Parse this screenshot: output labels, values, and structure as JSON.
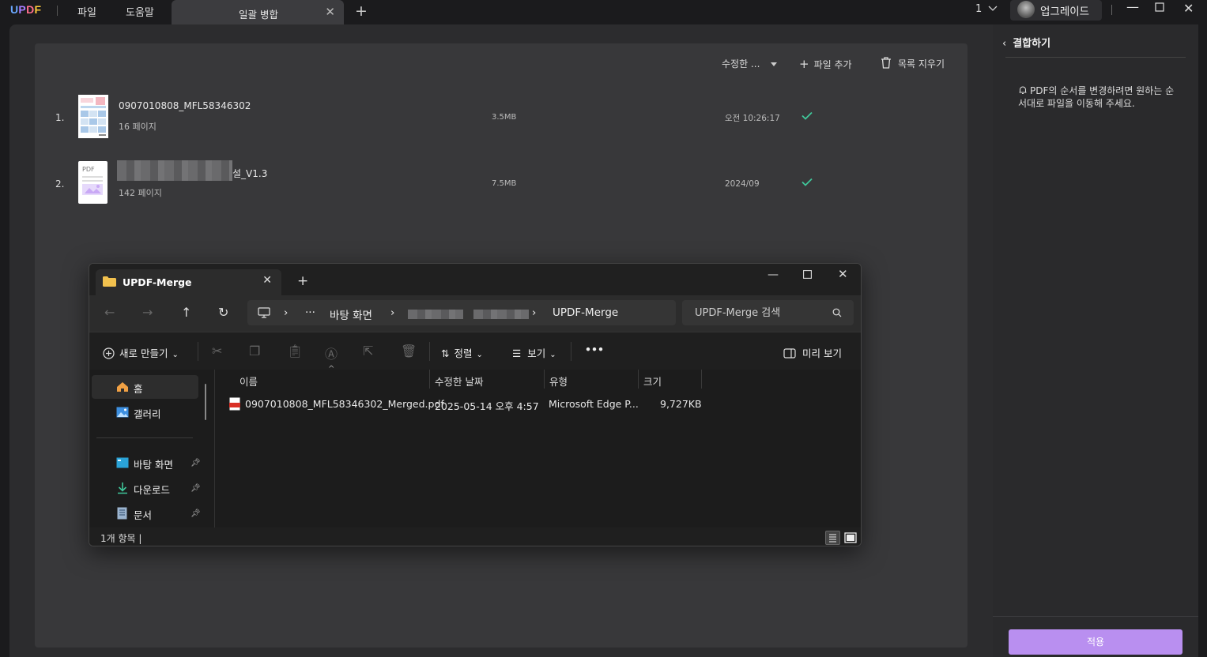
{
  "app": {
    "logo": {
      "u": "U",
      "p": "P",
      "d": "D",
      "f": "F"
    },
    "menu": [
      "파일",
      "도움말"
    ],
    "active_tab": "일괄 병합",
    "page_select": "1",
    "upgrade_label": "업그레이드"
  },
  "toolbar": {
    "sort_label": "수정한 ...",
    "add_file": "파일 추가",
    "clear_list": "목록 지우기"
  },
  "files": [
    {
      "index": "1.",
      "name": "0907010808_MFL58346302",
      "pages": "16 페이지",
      "size": "3.5MB",
      "date": "오전 10:26:17"
    },
    {
      "index": "2.",
      "name": "설_V1.3",
      "pages": "142 페이지",
      "size": "7.5MB",
      "date": "2024/09",
      "thumb_label": "PDF"
    }
  ],
  "sidebar": {
    "title": "결합하기",
    "info": "PDF의 순서를 변경하려면 원하는 순서대로 파일을 이동해 주세요.",
    "apply": "적용"
  },
  "explorer": {
    "tab_title": "UPDF-Merge",
    "address": {
      "desktop": "바탕 화면",
      "ellipsis": "···",
      "current": "UPDF-Merge"
    },
    "search_placeholder": "UPDF-Merge 검색",
    "commands": {
      "new": "새로 만들기",
      "sort": "정렬",
      "view": "보기",
      "more": "•••",
      "preview": "미리 보기"
    },
    "nav": {
      "home": "홈",
      "gallery": "갤러리",
      "desktop": "바탕 화면",
      "downloads": "다운로드",
      "documents": "문서"
    },
    "columns": {
      "name": "이름",
      "modified": "수정한 날짜",
      "type": "유형",
      "size": "크기"
    },
    "rows": [
      {
        "name": "0907010808_MFL58346302_Merged.pdf",
        "modified": "2025-05-14 오후 4:57",
        "type": "Microsoft Edge P...",
        "size": "9,727KB"
      }
    ],
    "status": "1개 항목  |"
  },
  "colors": {
    "accent": "#b98ff0",
    "check": "#3fc79a",
    "folder": "#f2c14e"
  }
}
